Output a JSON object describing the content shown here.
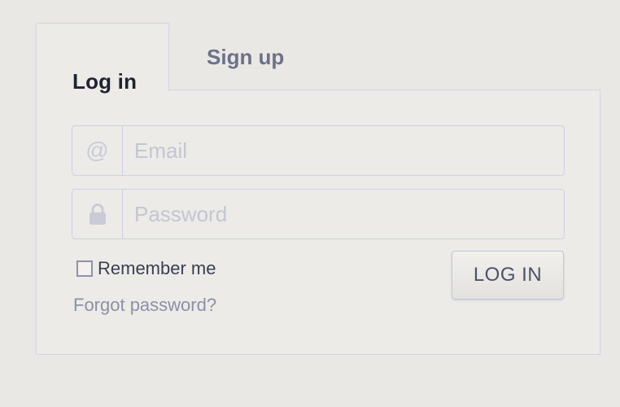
{
  "tabs": {
    "login_label": "Log in",
    "signup_label": "Sign up"
  },
  "email": {
    "icon": "at-icon",
    "icon_glyph": "@",
    "placeholder": "Email",
    "value": ""
  },
  "password": {
    "icon": "lock-icon",
    "placeholder": "Password",
    "value": ""
  },
  "remember": {
    "label": "Remember me",
    "checked": false
  },
  "forgot_label": "Forgot password?",
  "login_button_label": "LOG IN",
  "colors": {
    "background": "#e9e8e4",
    "border": "#d2d5e6",
    "tab_active_text": "#1f2230",
    "tab_inactive_text": "#6d7189",
    "link": "#8c90a8"
  }
}
